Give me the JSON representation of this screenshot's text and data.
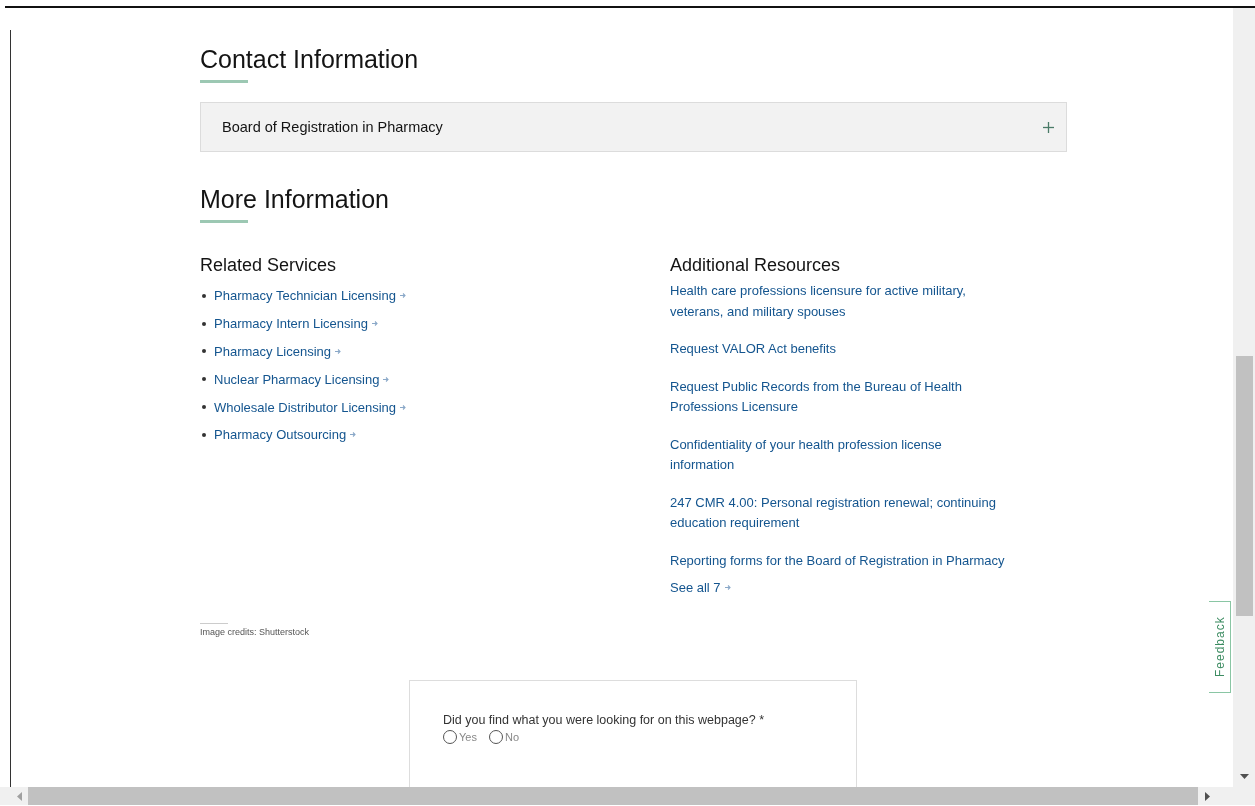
{
  "contact": {
    "heading": "Contact Information",
    "accordion": {
      "title": "Board of Registration in Pharmacy",
      "expanded": false
    }
  },
  "more_information": {
    "heading": "More Information",
    "related_services": {
      "heading": "Related Services",
      "items": [
        {
          "label": "Pharmacy Technician Licensing"
        },
        {
          "label": "Pharmacy Intern Licensing"
        },
        {
          "label": "Pharmacy Licensing"
        },
        {
          "label": "Nuclear Pharmacy Licensing"
        },
        {
          "label": "Wholesale Distributor Licensing"
        },
        {
          "label": "Pharmacy Outsourcing"
        }
      ]
    },
    "additional_resources": {
      "heading": "Additional Resources",
      "items": [
        {
          "label": "Health care professions licensure for active military, veterans, and military spouses"
        },
        {
          "label": "Request VALOR Act benefits"
        },
        {
          "label": "Request Public Records from the Bureau of Health Professions Licensure"
        },
        {
          "label": "Confidentiality of your health profession license information"
        },
        {
          "label": "247 CMR 4.00: Personal registration renewal; continuing education requirement"
        },
        {
          "label": "Reporting forms for the Board of Registration in Pharmacy"
        }
      ],
      "see_all": "See all 7"
    }
  },
  "image_credits": "Image credits:  Shutterstock",
  "survey": {
    "question": "Did you find what you were looking for on this webpage? *",
    "options": [
      {
        "label": "Yes",
        "selected": false
      },
      {
        "label": "No",
        "selected": false
      }
    ]
  },
  "feedback_tab": "Feedback"
}
